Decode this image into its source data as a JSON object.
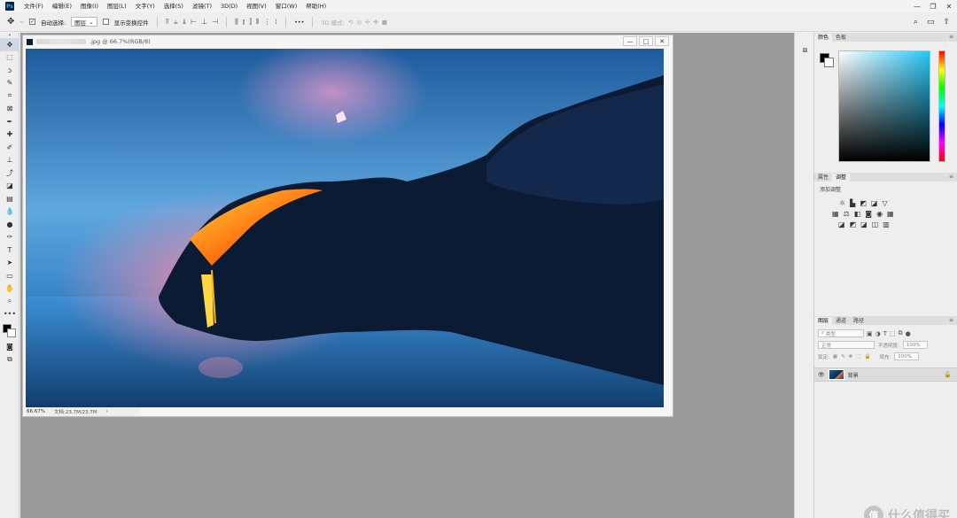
{
  "app": {
    "logo": "Ps"
  },
  "menu": [
    "文件(F)",
    "编辑(E)",
    "图像(I)",
    "图层(L)",
    "文字(Y)",
    "选择(S)",
    "滤镜(T)",
    "3D(D)",
    "视图(V)",
    "窗口(W)",
    "帮助(H)"
  ],
  "window_controls": {
    "minimize": "—",
    "restore": "❐",
    "close": "✕"
  },
  "options": {
    "auto_select_label": "自动选择:",
    "auto_select_value": "图层",
    "transform_label": "显示变换控件",
    "more": "•••",
    "mode_3d": "3D 模式:"
  },
  "document": {
    "title": ".jpg @ 66.7%(RGB/8)",
    "zoom": "66.67%",
    "doc_size": "文档:23.7M/23.7M",
    "btn_min": "—",
    "btn_max": "□",
    "btn_close": "✕"
  },
  "color_panel": {
    "tabs": [
      "颜色",
      "色板"
    ],
    "colors": {
      "foreground": "#000000",
      "background": "#ffffff"
    }
  },
  "adjust_panel": {
    "tabs": [
      "属性",
      "调整"
    ],
    "subtitle": "添加调整"
  },
  "layers_panel": {
    "tabs": [
      "图层",
      "通道",
      "路径"
    ],
    "filter_placeholder": "类型",
    "blend_mode": "正常",
    "opacity_label": "不透明度:",
    "opacity_value": "100%",
    "lock_label": "锁定:",
    "fill_label": "填充:",
    "fill_value": "100%",
    "layer_name": "背景"
  },
  "watermark": {
    "logo": "值",
    "text": "什么值得买"
  }
}
